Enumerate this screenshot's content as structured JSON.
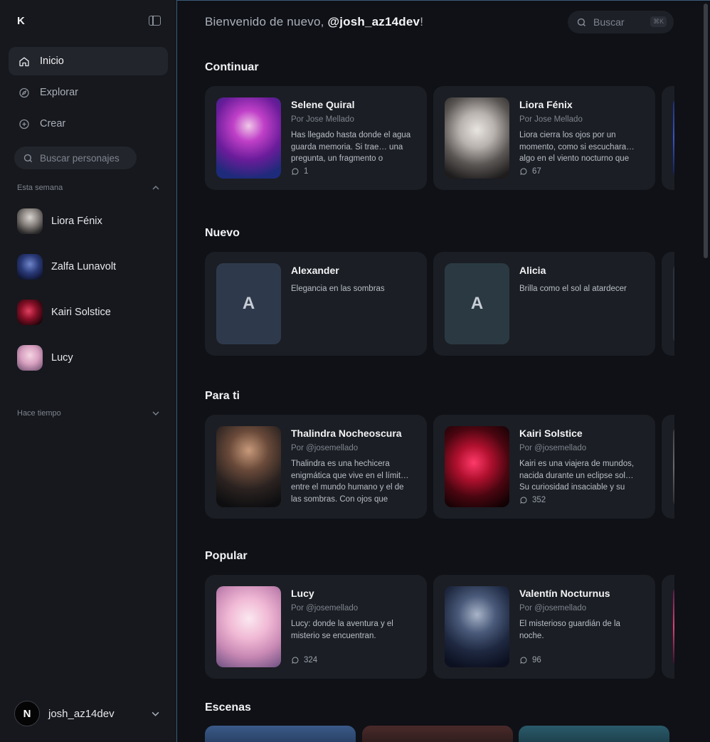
{
  "sidebar": {
    "logo": "K",
    "nav": [
      {
        "label": "Inicio",
        "icon": "home-icon"
      },
      {
        "label": "Explorar",
        "icon": "compass-icon"
      },
      {
        "label": "Crear",
        "icon": "plus-icon"
      }
    ],
    "search_placeholder": "Buscar personajes",
    "this_week_label": "Esta semana",
    "chats": [
      "Liora Fénix",
      "Zalfa Lunavolt",
      "Kairi Solstice",
      "Lucy"
    ],
    "long_ago_label": "Hace tiempo",
    "user": {
      "initial": "N",
      "name": "josh_az14dev"
    }
  },
  "header": {
    "welcome_prefix": "Bienvenido de nuevo, ",
    "username": "@josh_az14dev",
    "welcome_suffix": "!",
    "search_placeholder": "Buscar",
    "shortcut": "⌘K"
  },
  "sections": {
    "continuar": {
      "title": "Continuar",
      "cards": [
        {
          "name": "Selene Quiral",
          "author": "Por Jose Mellado",
          "desc": "Has llegado hasta donde el agua guarda memoria. Si trae… una pregunta, un fragmento o",
          "count": "1"
        },
        {
          "name": "Liora Fénix",
          "author": "Por Jose Mellado",
          "desc": "Liora cierra los ojos por un momento, como si escuchara… algo en el viento nocturno que",
          "count": "67"
        }
      ]
    },
    "nuevo": {
      "title": "Nuevo",
      "cards": [
        {
          "name": "Alexander",
          "letter": "A",
          "desc": "Elegancia en las sombras"
        },
        {
          "name": "Alicia",
          "letter": "A",
          "desc": "Brilla como el sol al atardecer"
        }
      ]
    },
    "para_ti": {
      "title": "Para ti",
      "cards": [
        {
          "name": "Thalindra Nocheoscura",
          "author": "Por @josemellado",
          "desc": "Thalindra es una hechicera enigmática que vive en el límit… entre el mundo humano y el de las sombras. Con ojos que"
        },
        {
          "name": "Kairi Solstice",
          "author": "Por @josemellado",
          "desc": "Kairi es una viajera de mundos, nacida durante un eclipse sol… Su curiosidad insaciable y su",
          "count": "352"
        }
      ]
    },
    "popular": {
      "title": "Popular",
      "cards": [
        {
          "name": "Lucy",
          "author": "Por @josemellado",
          "desc": "Lucy: donde la aventura y el misterio se encuentran.",
          "count": "324"
        },
        {
          "name": "Valentín Nocturnus",
          "author": "Por @josemellado",
          "desc": "El misterioso guardián de la noche.",
          "count": "96"
        }
      ]
    },
    "escenas": {
      "title": "Escenas"
    }
  },
  "colors": {
    "background": "#0f1116",
    "sidebar": "#16181d",
    "card": "#1b1e24",
    "active_nav": "#22252c",
    "accent_border": "#3b5b7a"
  }
}
